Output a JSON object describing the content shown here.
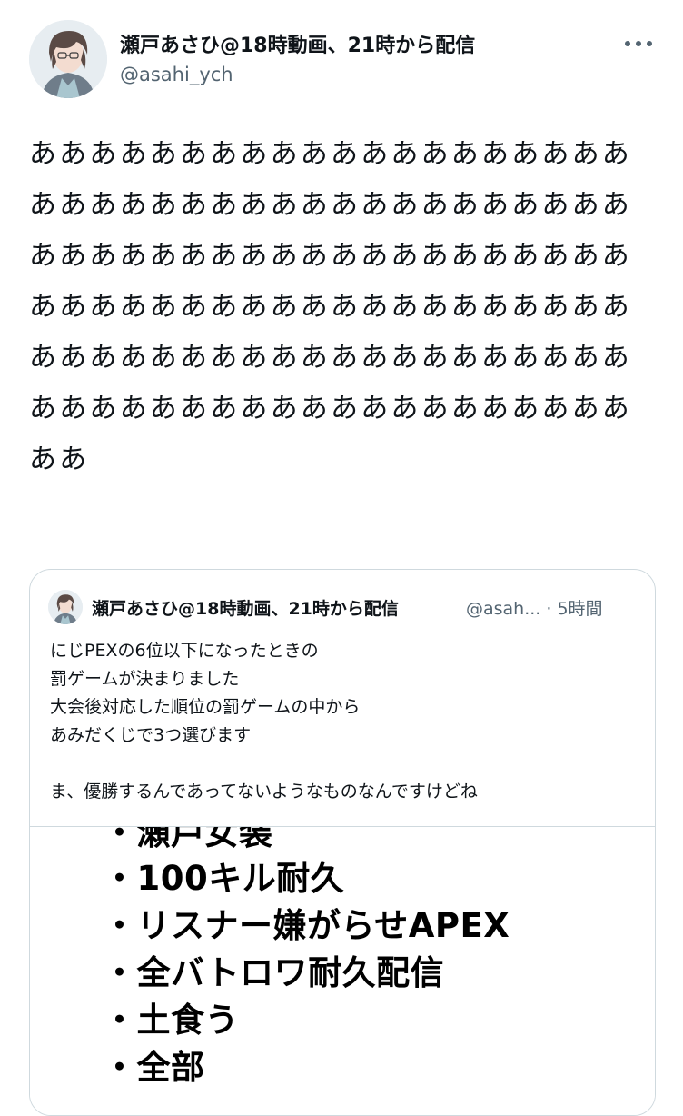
{
  "tweet": {
    "display_name": "瀬戸あさひ@18時動画、21時から配信",
    "handle": "@asahi_ych",
    "text": "ああああああああああああああああああああああああああああああああああああああああああああああああああああああああああああああああああああああああああああああああああああああああああああああああああああああああああああああああああああああああああ"
  },
  "quote": {
    "display_name": "瀬戸あさひ@18時動画、21時から配信",
    "handle_time": "@asah... · 5時間",
    "lines": [
      "にじPEXの6位以下になったときの",
      "罰ゲームが決まりました",
      "大会後対応した順位の罰ゲームの中から",
      "あみだくじで3つ選びます",
      "",
      "ま、優勝するんであってないようなものなんですけどね"
    ],
    "image_lines": [
      "・瀬戸女装",
      "・100キル耐久",
      "・リスナー嫌がらせAPEX",
      "・全バトロワ耐久配信",
      "・土食う",
      "・全部"
    ]
  },
  "icons": {
    "more": "more-horizontal-icon",
    "avatar": "avatar-image",
    "quote_avatar": "quote-avatar-image"
  },
  "colors": {
    "text": "#0f1419",
    "secondary": "#536471",
    "border": "#cfd9de"
  }
}
